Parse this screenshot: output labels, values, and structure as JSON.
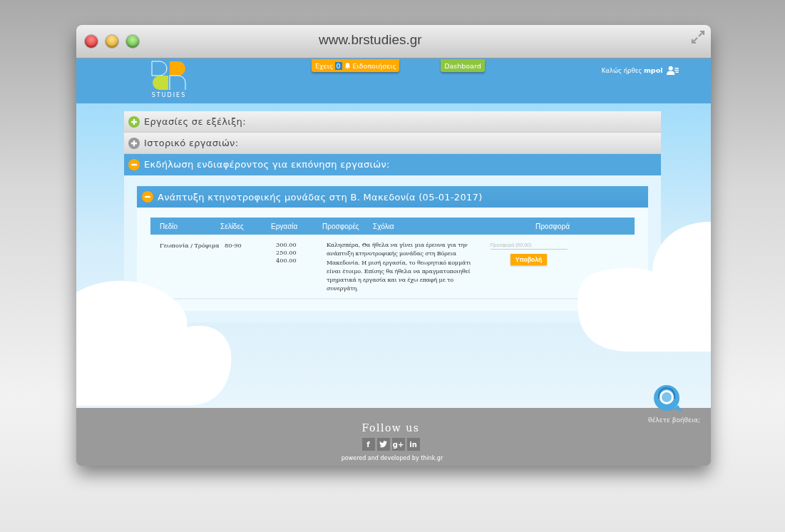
{
  "window": {
    "title": "www.brstudies.gr"
  },
  "header": {
    "logo_text": "STUDIES",
    "notifications": {
      "prefix": "Έχεις",
      "count": "0",
      "label": "Ειδοποιήσεις"
    },
    "dashboard": "Dashboard",
    "welcome": "Καλώς ήρθες",
    "user": "mpol"
  },
  "sections": [
    {
      "title": "Εργασίες σε εξέλιξη:",
      "expanded": false,
      "color": "#8cc63f"
    },
    {
      "title": "Ιστορικό εργασιών:",
      "expanded": false,
      "color": "#999999"
    },
    {
      "title": "Εκδήλωση ενδιαφέροντος για εκπόνηση εργασιών:",
      "expanded": true,
      "color": "#ffaa00"
    }
  ],
  "project": {
    "title": "Ανάπτυξη κτηνοτροφικής μονάδας στη Β. Μακεδονία (05-01-2017)",
    "expanded": true,
    "table": {
      "columns": [
        "Πεδίο",
        "Σελίδες",
        "Εργασία",
        "Προσφορές",
        "Σχόλια",
        "Προσφορά"
      ],
      "rows": [
        {
          "field": "Γεωπονία / Τρόφιμα",
          "pages": "80-90",
          "work": [
            "300.00",
            "250.00",
            "400.00"
          ],
          "comment": "Καλησπέρα, Θα ήθελα να γίνει μια έρευνα για την ανάπτυξη κτηνοτροφικής μονάδας στη Βόρεια Μακεδονία. Η μισή εργασία, το θεωρητικό κομμάτι είναι έτοιμο. Επίσης θα ήθελα να πραγματοποιηθεί τμηματικά η εργασία και να έχω επαφή με το συνεργάτη.",
          "offer_placeholder": "Προσφορά (00.00)",
          "submit": "Υποβολή"
        }
      ]
    }
  },
  "help": {
    "label": "θέλετε βοήθεια;"
  },
  "footer": {
    "title": "Follow us",
    "social": [
      {
        "kind": "facebook",
        "label": "f"
      },
      {
        "kind": "twitter"
      },
      {
        "kind": "googleplus",
        "label": "g+"
      },
      {
        "kind": "linkedin",
        "label": "in"
      }
    ],
    "credit": "powered and developed by think.gr"
  }
}
